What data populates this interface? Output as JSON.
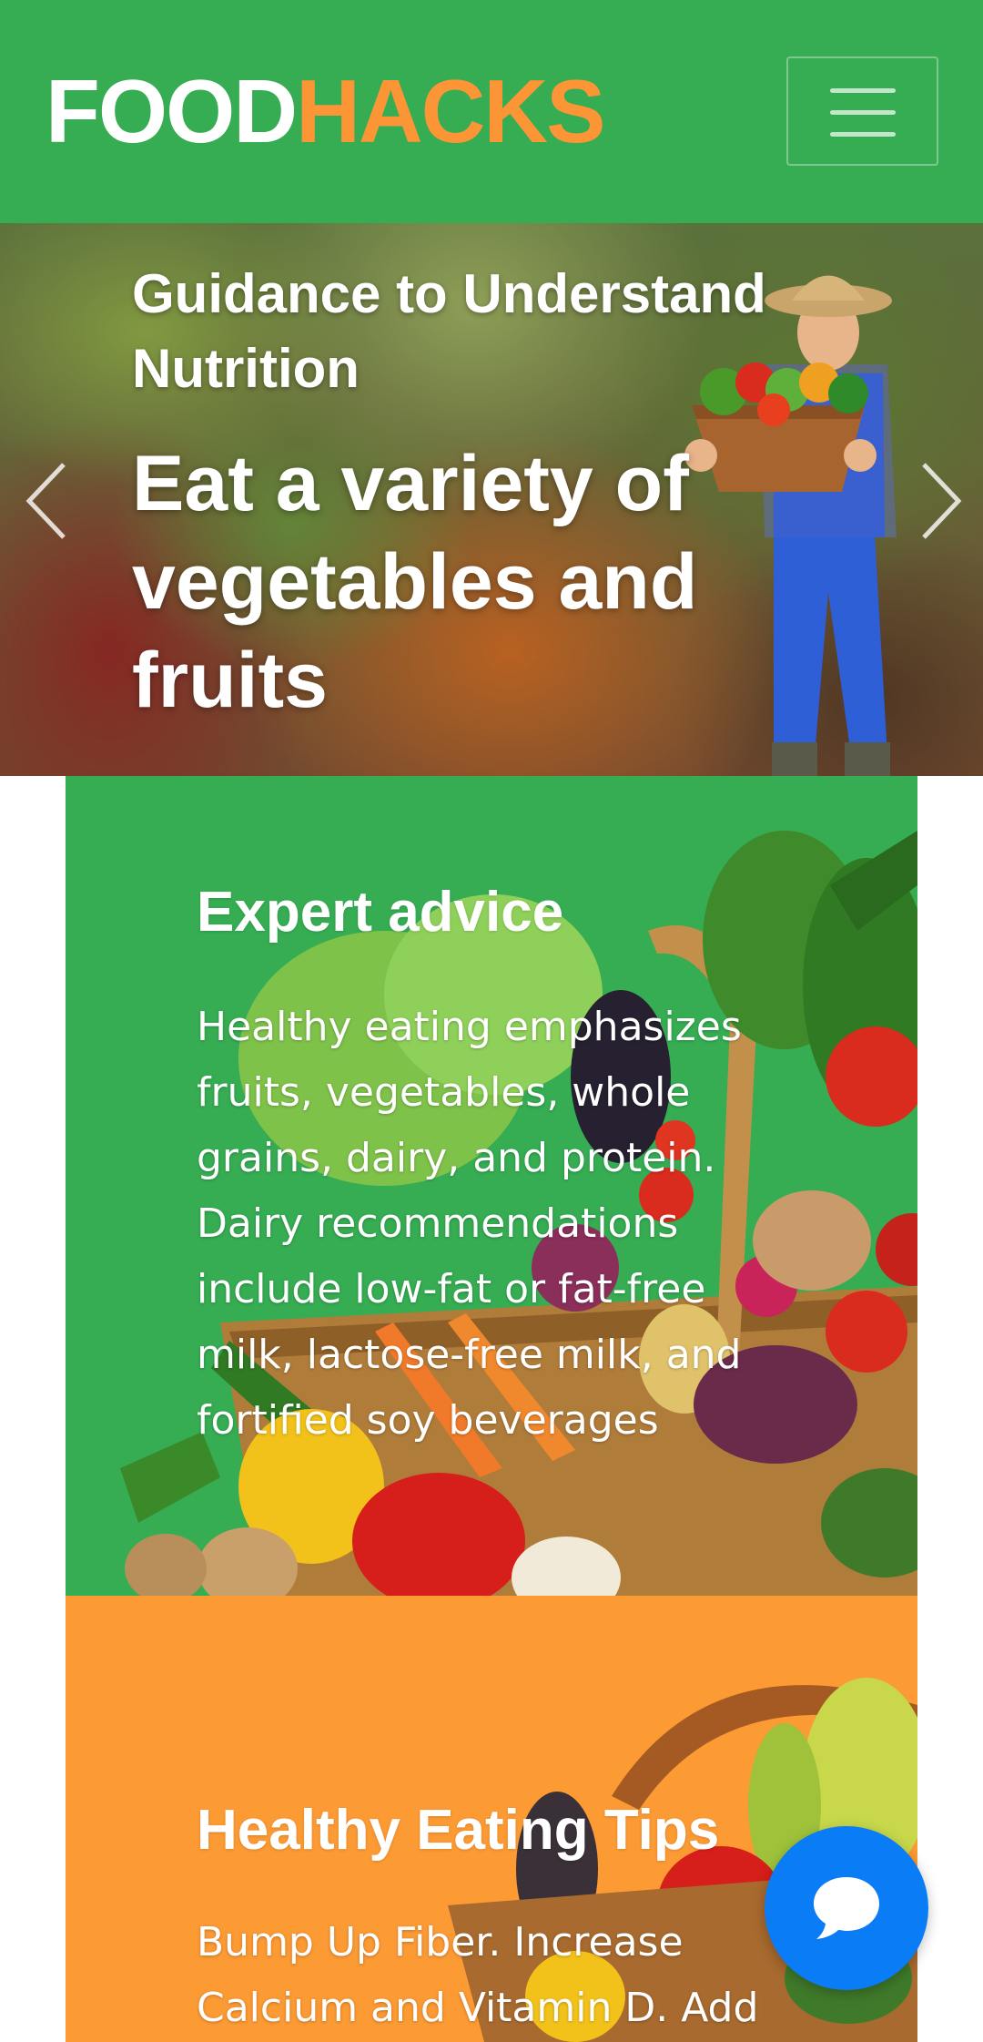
{
  "header": {
    "logo_part1": "FOOD",
    "logo_part2": "HACKS",
    "menu_icon": "hamburger-menu-icon",
    "colors": {
      "background": "#36ad53",
      "logo_accent": "#fc9536",
      "logo_main": "#ffffff"
    }
  },
  "hero": {
    "subtitle": "Guidance to Understand Nutrition",
    "title": "Eat a variety of vegetables and fruits",
    "prev_icon": "chevron-left-icon",
    "next_icon": "chevron-right-icon"
  },
  "cards": [
    {
      "title": "Expert advice",
      "text": "Healthy eating emphasizes fruits, vegetables, whole grains, dairy, and protein. Dairy recommendations include low-fat or fat-free milk, lactose-free milk, and fortified soy beverages",
      "color": "#36ad53"
    },
    {
      "title": "Healthy Eating Tips",
      "text": "Bump Up Fiber. Increase Calcium and Vitamin D. Add",
      "color": "#fc9a34"
    }
  ],
  "chat": {
    "icon": "chat-bubble-icon",
    "color": "#0a7cf5"
  }
}
